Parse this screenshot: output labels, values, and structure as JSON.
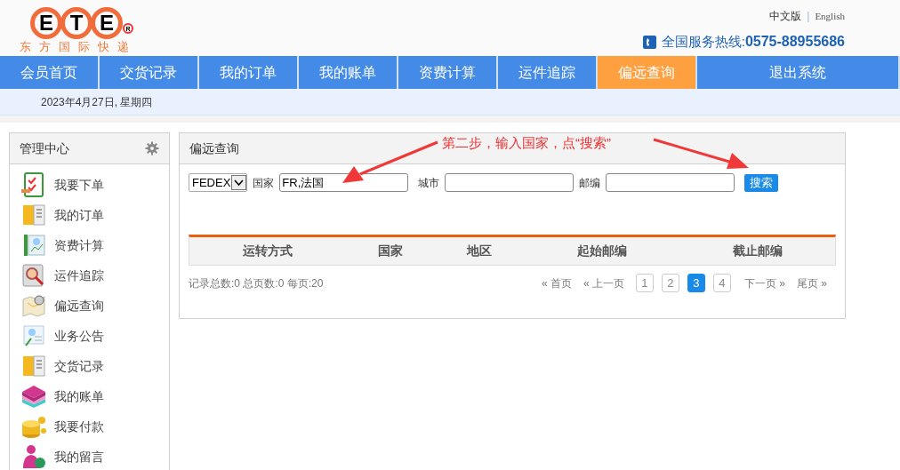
{
  "logo": {
    "letters": [
      "E",
      "T",
      "E"
    ],
    "mark": "R",
    "tagline": [
      "东",
      "方",
      "国",
      "际",
      "快",
      "递"
    ]
  },
  "lang": {
    "items": [
      "中文版",
      "English"
    ],
    "separator": "|"
  },
  "hotline": {
    "label": "全国服务热线:",
    "number": "0575-88955686"
  },
  "nav": [
    {
      "label": "会员首页",
      "selected": false
    },
    {
      "label": "交货记录",
      "selected": false
    },
    {
      "label": "我的订单",
      "selected": false
    },
    {
      "label": "我的账单",
      "selected": false
    },
    {
      "label": "资费计算",
      "selected": false
    },
    {
      "label": "运件追踪",
      "selected": false
    },
    {
      "label": "偏远查询",
      "selected": true
    },
    {
      "label": "退出系统",
      "selected": false
    }
  ],
  "date": "2023年4月27日, 星期四",
  "sidebar": {
    "title": "管理中心",
    "items": [
      "我要下单",
      "我的订单",
      "资费计算",
      "运件追踪",
      "偏远查询",
      "业务公告",
      "交货记录",
      "我的账单",
      "我要付款",
      "我的留言"
    ]
  },
  "panel": {
    "title": "偏远查询",
    "form": {
      "carrier": "FEDEX",
      "country_label": "国家",
      "country_value": "FR,法国",
      "city_label": "城市",
      "zip_label": "邮编",
      "search_button": "搜索"
    },
    "table": {
      "columns": [
        "运转方式",
        "国家",
        "地区",
        "起始邮编",
        "截止邮编"
      ]
    },
    "summary": "记录总数:0 总页数:0 每页:20",
    "pagination": {
      "first": "« 首页",
      "prev": "« 上一页",
      "pages": [
        {
          "label": "1",
          "selected": false
        },
        {
          "label": "2",
          "selected": false
        },
        {
          "label": "3",
          "selected": true
        },
        {
          "label": "4",
          "selected": false
        }
      ],
      "next": "下一页 »",
      "last": "尾页 »"
    }
  },
  "annotation": "第二步，输入国家，点“搜索”"
}
